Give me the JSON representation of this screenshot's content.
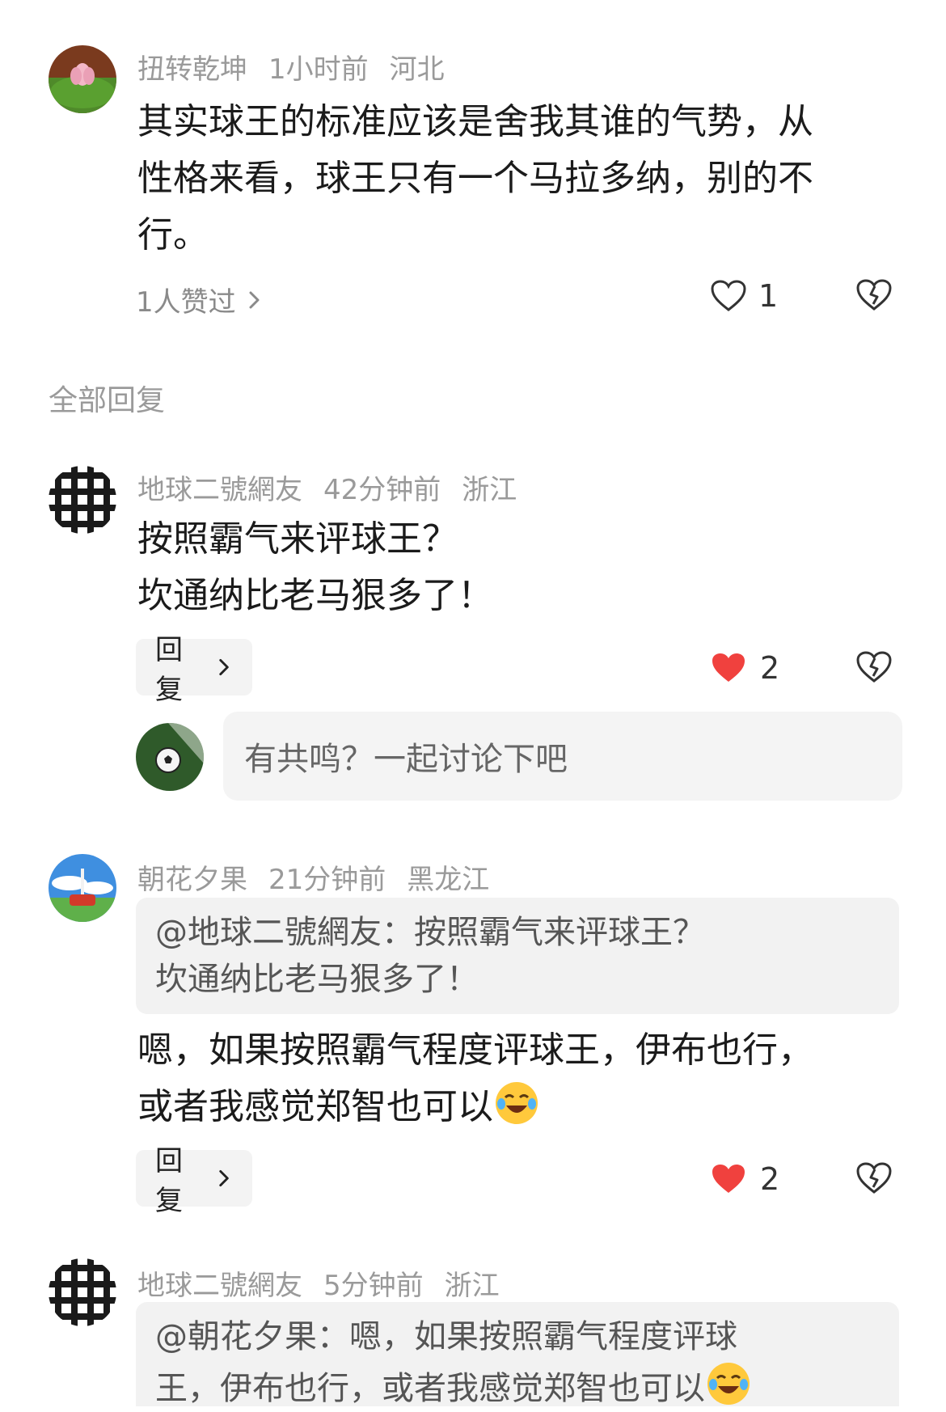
{
  "main_comment": {
    "username": "扭转乾坤",
    "time": "1小时前",
    "location": "河北",
    "text_line1": "其实球王的标准应该是舍我其谁的气势，从",
    "text_line2": "性格来看，球王只有一个马拉多纳，别的不",
    "text_line3": "行。",
    "liked_by": "1人赞过",
    "like_count": "1"
  },
  "section_label": "全部回复",
  "replies": [
    {
      "username": "地球二號網友",
      "time": "42分钟前",
      "location": "浙江",
      "text_line1": "按照霸气来评球王？",
      "text_line2": "坎通纳比老马狠多了！",
      "reply_label": "回复",
      "like_count": "2",
      "liked": true
    },
    {
      "username": "朝花夕果",
      "time": "21分钟前",
      "location": "黑龙江",
      "quote_line1": "@地球二號網友：按照霸气来评球王？",
      "quote_line2": "坎通纳比老马狠多了！",
      "text_line1": "嗯，如果按照霸气程度评球王，伊布也行，",
      "text_line2": "或者我感觉郑智也可以",
      "reply_label": "回复",
      "like_count": "2",
      "liked": true
    },
    {
      "username": "地球二號網友",
      "time": "5分钟前",
      "location": "浙江",
      "quote_line1": "@朝花夕果：嗯，如果按照霸气程度评球",
      "quote_line2": "王，伊布也行，或者我感觉郑智也可以"
    }
  ],
  "composer": {
    "placeholder": "有共鸣？一起讨论下吧"
  },
  "colors": {
    "heart_red": "#f0413e",
    "meta_gray": "#9a9a9a"
  },
  "icons": {
    "like": "heart-outline-icon",
    "liked": "heart-filled-icon",
    "dislike": "broken-heart-icon",
    "chevron": "chevron-right-icon",
    "emoji": "laughing-crying-emoji"
  }
}
